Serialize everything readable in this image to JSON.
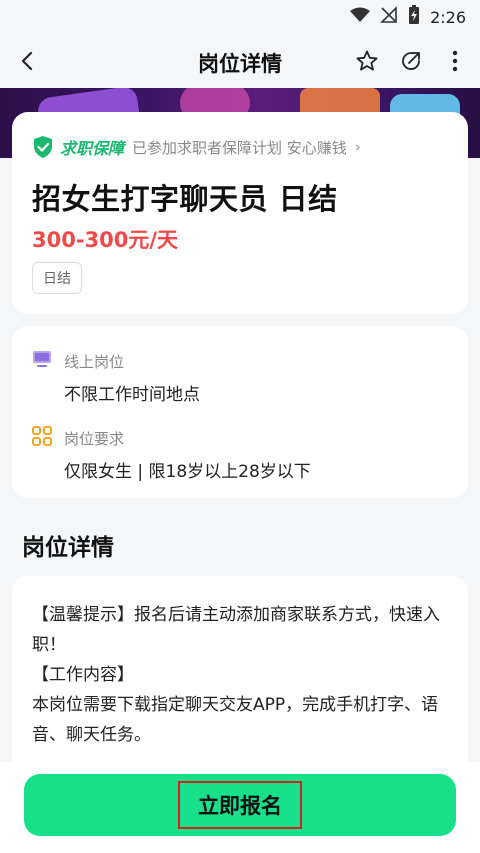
{
  "status_bar": {
    "time": "2:26"
  },
  "nav": {
    "title": "岗位详情"
  },
  "guarantee": {
    "brand": "求职保障",
    "text": "已参加求职者保障计划 安心赚钱",
    "chevron": "›"
  },
  "job": {
    "title": "招女生打字聊天员 日结",
    "salary": "300-300元/天",
    "tag": "日结"
  },
  "info": [
    {
      "label": "线上岗位",
      "value": "不限工作时间地点"
    },
    {
      "label": "岗位要求",
      "value": "仅限女生 | 限18岁以上28岁以下"
    }
  ],
  "section": {
    "title": "岗位详情"
  },
  "detail": {
    "lines": [
      "【温馨提示】报名后请主动添加商家联系方式，快速入职！",
      "【工作内容】",
      "本岗位需要下载指定聊天交友APP，完成手机打字、语音、聊天任务。"
    ]
  },
  "bottom": {
    "apply_label": "立即报名"
  },
  "colors": {
    "accent": "#16e08a",
    "salary": "#ef4a4a",
    "guarantee": "#1db870"
  }
}
